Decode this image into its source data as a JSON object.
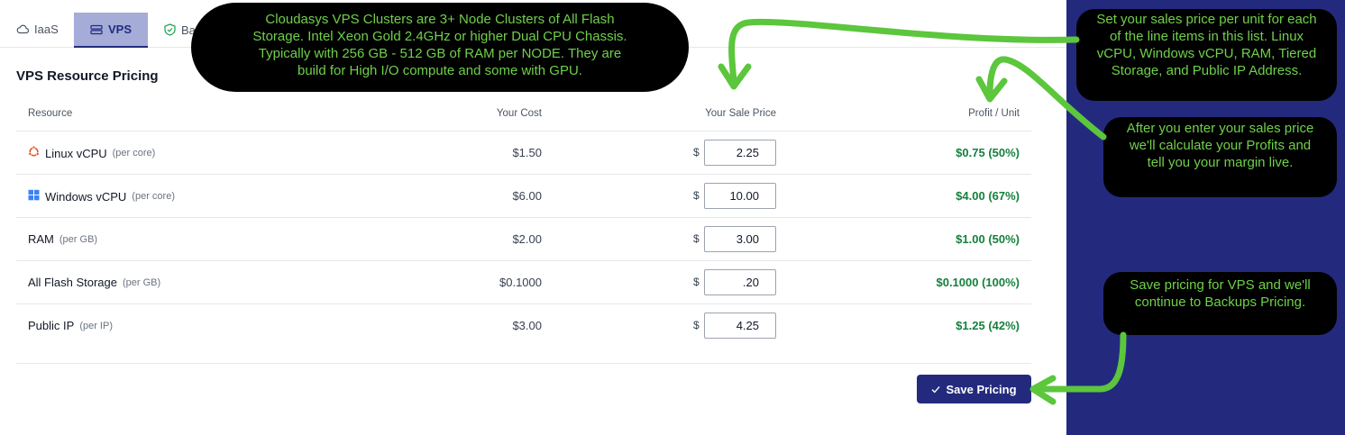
{
  "tabs": [
    {
      "label": "IaaS",
      "icon": "cloud-icon"
    },
    {
      "label": "VPS",
      "icon": "server-icon"
    },
    {
      "label": "Ba",
      "icon": "shield-icon"
    }
  ],
  "section_title": "VPS Resource Pricing",
  "table": {
    "headers": {
      "resource": "Resource",
      "cost": "Your Cost",
      "sale": "Your Sale Price",
      "profit": "Profit / Unit"
    },
    "currency_symbol": "$",
    "rows": [
      {
        "name": "Linux vCPU",
        "unit": "(per core)",
        "icon": "ubuntu-icon",
        "cost": "$1.50",
        "sale": "2.25",
        "profit": "$0.75 (50%)"
      },
      {
        "name": "Windows vCPU",
        "unit": "(per core)",
        "icon": "windows-icon",
        "cost": "$6.00",
        "sale": "10.00",
        "profit": "$4.00 (67%)"
      },
      {
        "name": "RAM",
        "unit": "(per GB)",
        "icon": "",
        "cost": "$2.00",
        "sale": "3.00",
        "profit": "$1.00 (50%)"
      },
      {
        "name": "All Flash Storage",
        "unit": "(per GB)",
        "icon": "",
        "cost": "$0.1000",
        "sale": ".20",
        "profit": "$0.1000 (100%)"
      },
      {
        "name": "Public IP",
        "unit": "(per IP)",
        "icon": "",
        "cost": "$3.00",
        "sale": "4.25",
        "profit": "$1.25 (42%)"
      }
    ]
  },
  "save_button": {
    "label": "Save Pricing",
    "icon": "check-icon"
  },
  "callouts": {
    "top": "Cloudasys VPS Clusters are 3+ Node Clusters of All Flash Storage. Intel Xeon Gold 2.4GHz or higher Dual CPU Chassis. Typically with 256 GB - 512 GB of RAM per NODE. They are build for High I/O compute and some with GPU.",
    "right1": "Set your sales price per unit for each of the line items in this list. Linux vCPU, Windows vCPU, RAM, Tiered Storage, and Public IP Address.",
    "right2": "After you enter your sales price we'll calculate your Profits and tell you your margin live.",
    "right3": "Save pricing for VPS and we'll continue to Backups Pricing."
  },
  "colors": {
    "brand": "#232a7e",
    "active_tab_bg": "#a5acd8",
    "profit": "#15803d",
    "callout_text": "#6fd04a",
    "arrow": "#5cc63c"
  }
}
